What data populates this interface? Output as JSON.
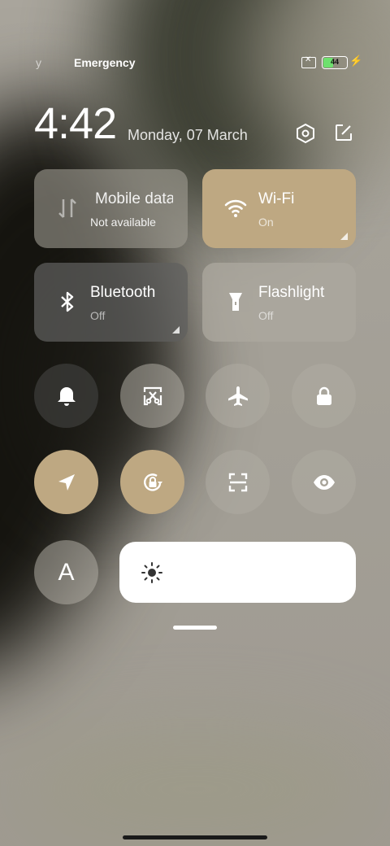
{
  "status_bar": {
    "left_fragment": "y",
    "carrier_text": "Emergency",
    "battery_level": "44",
    "icons": [
      "no-sim-icon",
      "battery-icon",
      "charging-bolt-icon"
    ]
  },
  "header": {
    "time": "4:42",
    "date": "Monday, 07 March",
    "icons": [
      "settings-hexagon-icon",
      "edit-icon"
    ]
  },
  "tiles": [
    {
      "title": "Mobile data",
      "subtitle": "Not available",
      "icon": "mobile-data-icon",
      "active": false
    },
    {
      "title": "Wi-Fi",
      "subtitle": "On",
      "icon": "wifi-icon",
      "active": true
    },
    {
      "title": "Bluetooth",
      "subtitle": "Off",
      "icon": "bluetooth-icon",
      "active": false
    },
    {
      "title": "Flashlight",
      "subtitle": "Off",
      "icon": "flashlight-icon",
      "active": false
    }
  ],
  "toggles": [
    {
      "name": "bell-icon",
      "active": false
    },
    {
      "name": "screenshot-icon",
      "active": false
    },
    {
      "name": "airplane-icon",
      "active": false
    },
    {
      "name": "lock-icon",
      "active": false
    },
    {
      "name": "location-icon",
      "active": true
    },
    {
      "name": "rotation-lock-icon",
      "active": true
    },
    {
      "name": "scanner-icon",
      "active": false
    },
    {
      "name": "eye-icon",
      "active": false
    }
  ],
  "font_toggle_label": "A",
  "brightness": {
    "icon": "sun-icon"
  },
  "colors": {
    "accent": "#bea882",
    "battery_fill": "#6ee06e"
  }
}
